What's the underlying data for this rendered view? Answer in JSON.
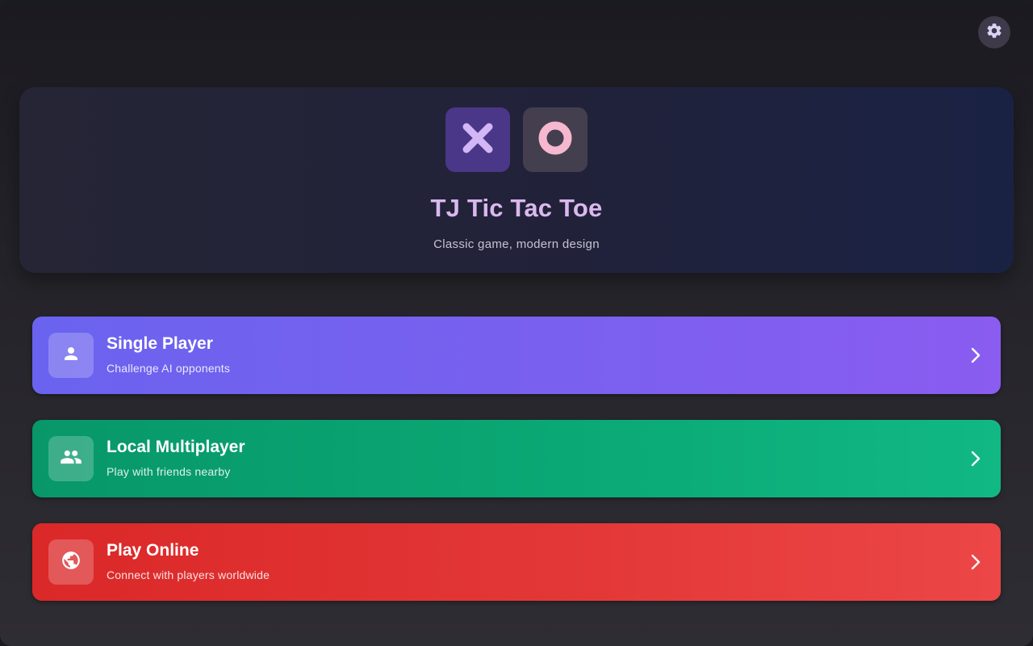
{
  "settings": {
    "icon": "gear-icon"
  },
  "hero": {
    "title": "TJ Tic Tac Toe",
    "subtitle": "Classic game, modern design",
    "x_tile_icon": "x-mark-icon",
    "o_tile_icon": "o-mark-icon"
  },
  "modes": [
    {
      "title": "Single Player",
      "subtitle": "Challenge AI opponents",
      "icon": "person-icon",
      "color": "#7461ef"
    },
    {
      "title": "Local Multiplayer",
      "subtitle": "Play with friends nearby",
      "icon": "people-icon",
      "color": "#0aa874"
    },
    {
      "title": "Play Online",
      "subtitle": "Connect with players worldwide",
      "icon": "globe-icon",
      "color": "#e33737"
    }
  ],
  "colors": {
    "x_accent": "#d3b6f6",
    "o_accent": "#f5b8cf",
    "background": "#1c1b22"
  }
}
